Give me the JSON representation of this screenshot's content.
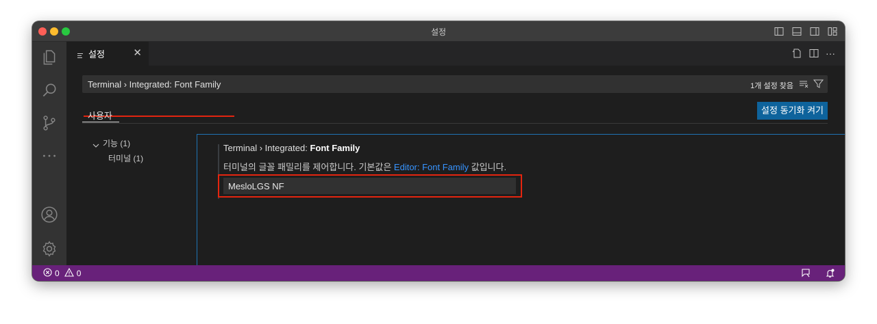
{
  "window": {
    "title": "설정"
  },
  "tab": {
    "label": "설정",
    "close_glyph": "✕"
  },
  "tab_actions": {
    "more_glyph": "···"
  },
  "search": {
    "value": "Terminal › Integrated: Font Family",
    "result_count": "1개 설정 찾음"
  },
  "scope": {
    "user_tab": "사용자",
    "sync_button": "설정 동기화 켜기"
  },
  "toc": {
    "features": "기능 (1)",
    "terminal": "터미널 (1)"
  },
  "setting": {
    "category": "Terminal › Integrated: ",
    "name": "Font Family",
    "description_prefix": "터미널의 글꼴 패밀리를 제어합니다. 기본값은 ",
    "description_link": "Editor: Font Family",
    "description_suffix": " 값입니다.",
    "value": "MesloLGS NF"
  },
  "status": {
    "errors": "0",
    "warnings": "0"
  },
  "colors": {
    "statusbar": "#68217a",
    "button": "#0e639c",
    "link": "#3794ff",
    "highlight": "#e5250f",
    "focus_border": "#1f74b5"
  },
  "icons": {
    "activity": [
      "explorer-icon",
      "search-icon",
      "source-control-icon",
      "more-icon",
      "account-icon",
      "gear-icon"
    ],
    "titlebar": [
      "toggle-sidebar-icon",
      "toggle-panel-icon",
      "toggle-secondary-sidebar-icon",
      "customize-layout-icon"
    ],
    "statusbar": [
      "error-icon",
      "warning-icon",
      "feedback-icon",
      "bell-icon"
    ]
  }
}
